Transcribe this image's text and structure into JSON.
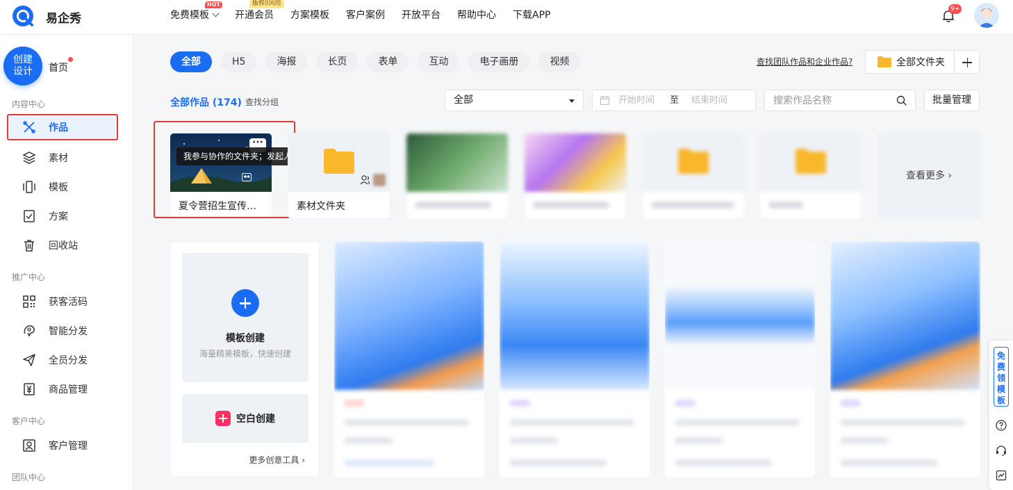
{
  "header": {
    "brand": "易企秀",
    "nav": [
      {
        "label": "免费模板",
        "badge": "HOT"
      },
      {
        "label": "开通会员",
        "badge": "版权0风险"
      },
      {
        "label": "方案模板"
      },
      {
        "label": "客户案例"
      },
      {
        "label": "开放平台"
      },
      {
        "label": "帮助中心"
      },
      {
        "label": "下载APP"
      }
    ],
    "notification_count": "9+"
  },
  "sidebar": {
    "create_label": "创建\n设计",
    "create_line1": "创建",
    "create_line2": "设计",
    "home": "首页",
    "sections": {
      "content": "内容中心",
      "promote": "推广中心",
      "customer": "客户中心",
      "team": "团队中心"
    },
    "items": {
      "works": "作品",
      "materials": "素材",
      "templates": "模板",
      "plans": "方案",
      "recycle": "回收站",
      "qrcode": "获客活码",
      "smart_share": "智能分发",
      "all_share": "全员分发",
      "products": "商品管理",
      "customers": "客户管理"
    }
  },
  "filters": {
    "pills": [
      "全部",
      "H5",
      "海报",
      "长页",
      "表单",
      "互动",
      "电子画册",
      "视频"
    ],
    "active_pill": "全部",
    "team_link": "查找团队作品和企业作品?",
    "all_folders": "全部文件夹",
    "works_title": "全部作品 (174)",
    "find_group": "查找分组",
    "select_value": "全部",
    "date_start_placeholder": "开始时间",
    "date_to": "至",
    "date_end_placeholder": "结束时间",
    "search_placeholder": "搜索作品名称",
    "batch": "批量管理"
  },
  "folders": {
    "first_label": "夏令营招生宣传…",
    "tooltip": "我参与协作的文件夹；发起人",
    "second_label": "素材文件夹",
    "more": "查看更多 ›"
  },
  "create_panel": {
    "template_title": "模板创建",
    "template_sub": "海量精美模板，快速创建",
    "blank": "空白创建",
    "more_tools": "更多创意工具 ›"
  },
  "float_bar": {
    "free_template": "免费领模板"
  },
  "colors": {
    "primary": "#1a6cf2",
    "highlight": "#e53935",
    "blank_icon": "#ff2e63"
  }
}
